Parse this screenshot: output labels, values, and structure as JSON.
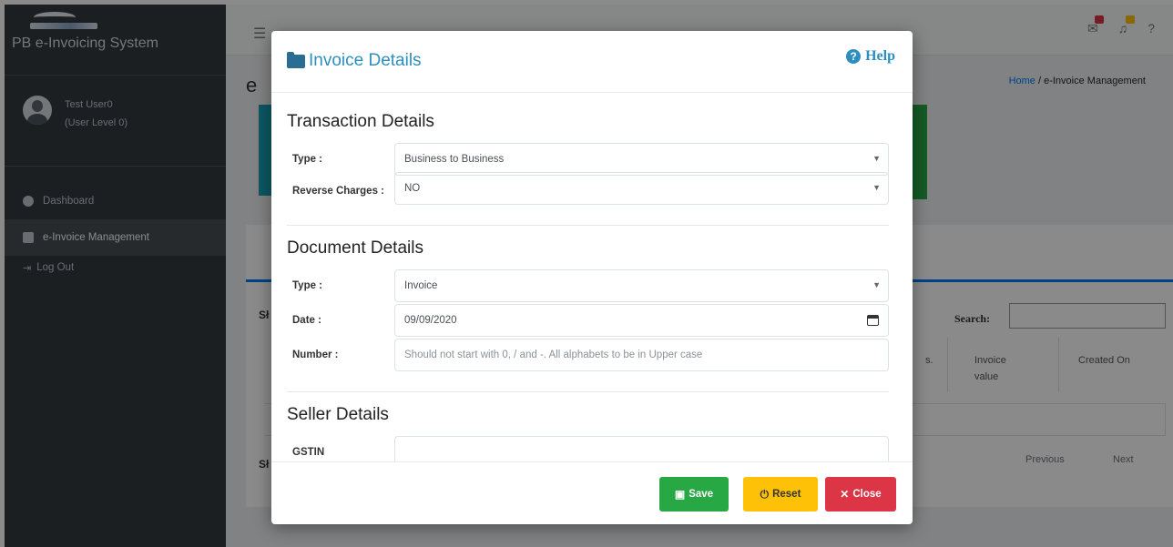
{
  "sidebar": {
    "brand_title": "PB e-Invoicing System",
    "user_name": "Test User0",
    "user_level": "(User Level 0)",
    "items": [
      {
        "label": "Dashboard",
        "icon": "dashboard-icon"
      },
      {
        "label": "e-Invoice Management",
        "icon": "book-icon"
      }
    ],
    "logout_label": "Log Out"
  },
  "breadcrumb": {
    "home": "Home",
    "separator": "/",
    "current": "e-Invoice Management"
  },
  "table": {
    "search_label": "Search:",
    "columns": [
      "Invoice value",
      "Created On"
    ],
    "col_fragment": "s.",
    "pagination": {
      "previous": "Previous",
      "next": "Next"
    }
  },
  "modal": {
    "title": "Invoice Details",
    "help_label": "Help",
    "sections": {
      "transaction": {
        "title": "Transaction Details",
        "type_label": "Type :",
        "type_value": "Business to Business",
        "reverse_label": "Reverse Charges :",
        "reverse_value": "NO"
      },
      "document": {
        "title": "Document Details",
        "type_label": "Type :",
        "type_value": "Invoice",
        "date_label": "Date :",
        "date_value": "09/09/2020",
        "number_label": "Number :",
        "number_placeholder": "Should not start with 0, / and -. All alphabets to be in Upper case"
      },
      "seller": {
        "title": "Seller Details",
        "gstin_label": "GSTIN"
      }
    },
    "buttons": {
      "save": "Save",
      "reset": "Reset",
      "close": "Close"
    }
  },
  "colors": {
    "accent": "#2d8fbf",
    "save": "#28a745",
    "reset": "#ffc107",
    "close": "#dc3545",
    "sidebar_bg": "#343a40"
  }
}
